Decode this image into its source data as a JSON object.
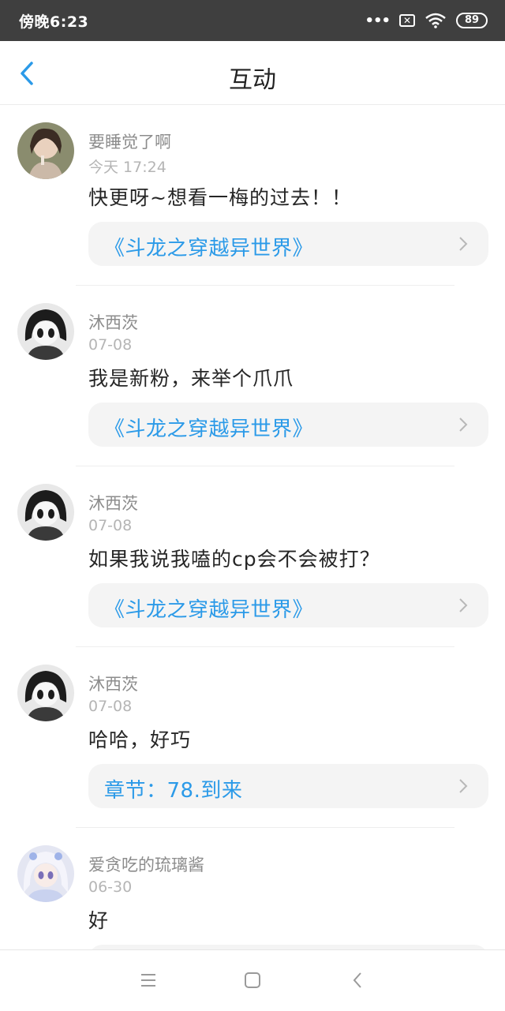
{
  "status_bar": {
    "time": "傍晚6:23",
    "battery": "89",
    "icons": [
      "more-dots-icon",
      "sim-x-icon",
      "wifi-icon",
      "battery-icon"
    ]
  },
  "header": {
    "title": "互动",
    "back_icon": "chevron-left-icon"
  },
  "feed": [
    {
      "user": "要睡觉了啊",
      "time": "今天 17:24",
      "comment": "快更呀~想看一梅的过去！！",
      "link": "《斗龙之穿越异世界》",
      "avatar": "avatar-photo-girl"
    },
    {
      "user": "沐西茨",
      "time": "07-08",
      "comment": "我是新粉，来举个爪爪",
      "link": "《斗龙之穿越异世界》",
      "avatar": "avatar-anime-dark"
    },
    {
      "user": "沐西茨",
      "time": "07-08",
      "comment": "如果我说我嗑的cp会不会被打？",
      "link": "《斗龙之穿越异世界》",
      "avatar": "avatar-anime-dark"
    },
    {
      "user": "沐西茨",
      "time": "07-08",
      "comment": "哈哈，好巧",
      "link": "章节：78.到来",
      "avatar": "avatar-anime-dark"
    },
    {
      "user": "爱贪吃的琉璃酱",
      "time": "06-30",
      "comment": "好",
      "link": "",
      "avatar": "avatar-anime-white"
    }
  ],
  "colors": {
    "status_bar_bg": "#3f3f3f",
    "accent_link": "#2b9ae8",
    "card_bg": "#f4f4f4"
  },
  "navbar": {
    "icons": [
      "menu-icon",
      "home-square-icon",
      "back-triangle-icon"
    ]
  }
}
